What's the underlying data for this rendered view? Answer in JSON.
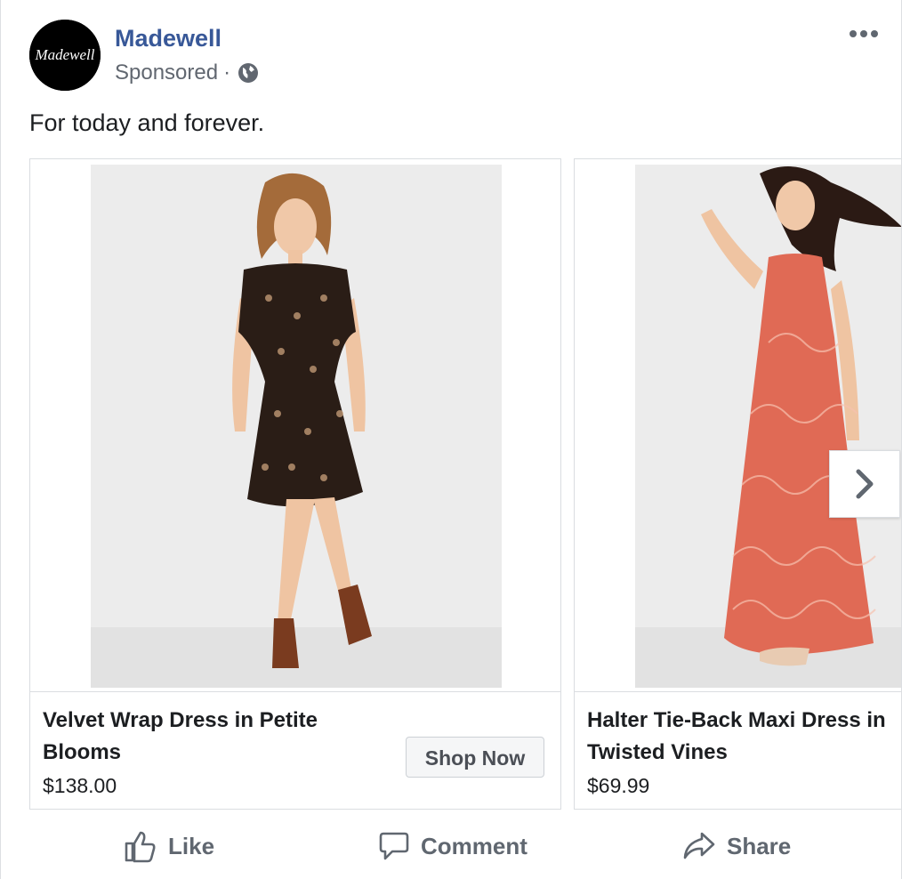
{
  "post": {
    "page_name": "Madewell",
    "avatar_text": "Madewell",
    "sponsored_label": "Sponsored",
    "separator": "·",
    "message": "For today and forever."
  },
  "carousel": {
    "cards": [
      {
        "title": "Velvet Wrap Dress in Petite Blooms",
        "price": "$138.00",
        "cta": "Shop Now",
        "dress_color": "#2a1d16"
      },
      {
        "title": "Halter Tie-Back Maxi Dress in Twisted Vines",
        "price": "$69.99",
        "dress_color": "#e06a55"
      }
    ]
  },
  "actions": {
    "like_label": "Like",
    "comment_label": "Comment",
    "share_label": "Share"
  },
  "colors": {
    "brand_link": "#385898",
    "meta_gray": "#616770",
    "action_gray": "#606770"
  },
  "icons": [
    "globe-icon",
    "more-icon",
    "chevron-right-icon",
    "like-icon",
    "comment-icon",
    "share-icon"
  ]
}
